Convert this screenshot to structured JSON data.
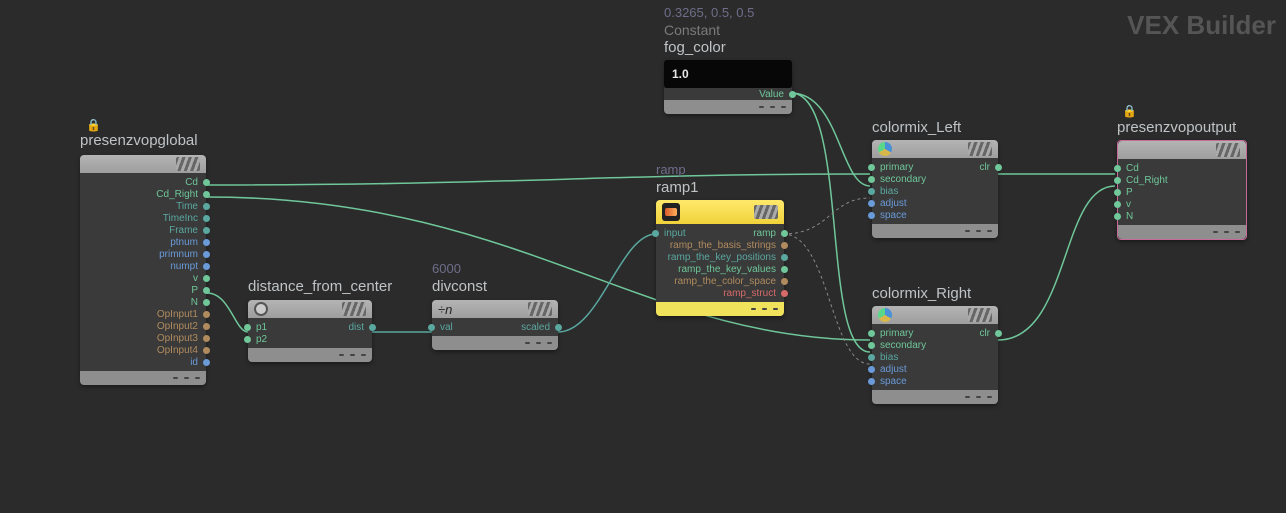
{
  "watermark": "VEX Builder",
  "constant": {
    "values_text": "0.3265, 0.5, 0.5",
    "type_text": "Constant",
    "name": "fog_color",
    "preview_value": "1.0",
    "out_label": "Value"
  },
  "global": {
    "name": "presenzvopglobal",
    "ports": [
      {
        "label": "Cd",
        "color": "green"
      },
      {
        "label": "Cd_Right",
        "color": "green"
      },
      {
        "label": "Time",
        "color": "teal"
      },
      {
        "label": "TimeInc",
        "color": "teal"
      },
      {
        "label": "Frame",
        "color": "teal"
      },
      {
        "label": "ptnum",
        "color": "blue"
      },
      {
        "label": "primnum",
        "color": "blue"
      },
      {
        "label": "numpt",
        "color": "blue"
      },
      {
        "label": "v",
        "color": "green"
      },
      {
        "label": "P",
        "color": "green"
      },
      {
        "label": "N",
        "color": "green"
      },
      {
        "label": "OpInput1",
        "color": "brown"
      },
      {
        "label": "OpInput2",
        "color": "brown"
      },
      {
        "label": "OpInput3",
        "color": "brown"
      },
      {
        "label": "OpInput4",
        "color": "brown"
      },
      {
        "label": "id",
        "color": "blue"
      }
    ]
  },
  "distance": {
    "name": "distance_from_center",
    "in": [
      {
        "label": "p1",
        "color": "green"
      },
      {
        "label": "p2",
        "color": "green"
      }
    ],
    "out": [
      {
        "label": "dist",
        "color": "teal"
      }
    ]
  },
  "divconst": {
    "value_text": "6000",
    "name": "divconst",
    "expr": "÷n",
    "in": [
      {
        "label": "val",
        "color": "teal"
      }
    ],
    "out": [
      {
        "label": "scaled",
        "color": "teal"
      }
    ]
  },
  "ramp": {
    "type_text": "ramp",
    "name": "ramp1",
    "in": [
      {
        "label": "input",
        "color": "teal"
      }
    ],
    "out": [
      {
        "label": "ramp",
        "color": "green"
      },
      {
        "label": "ramp_the_basis_strings",
        "color": "brown"
      },
      {
        "label": "ramp_the_key_positions",
        "color": "teal"
      },
      {
        "label": "ramp_the_key_values",
        "color": "green"
      },
      {
        "label": "ramp_the_color_space",
        "color": "brown"
      },
      {
        "label": "ramp_struct",
        "color": "red"
      }
    ]
  },
  "colormix_left": {
    "name": "colormix_Left",
    "in": [
      {
        "label": "primary",
        "color": "green"
      },
      {
        "label": "secondary",
        "color": "green"
      },
      {
        "label": "bias",
        "color": "teal"
      },
      {
        "label": "adjust",
        "color": "blue"
      },
      {
        "label": "space",
        "color": "blue"
      }
    ],
    "out": [
      {
        "label": "clr",
        "color": "green"
      }
    ]
  },
  "colormix_right": {
    "name": "colormix_Right",
    "in": [
      {
        "label": "primary",
        "color": "green"
      },
      {
        "label": "secondary",
        "color": "green"
      },
      {
        "label": "bias",
        "color": "teal"
      },
      {
        "label": "adjust",
        "color": "blue"
      },
      {
        "label": "space",
        "color": "blue"
      }
    ],
    "out": [
      {
        "label": "clr",
        "color": "green"
      }
    ]
  },
  "output": {
    "name": "presenzvopoutput",
    "in": [
      {
        "label": "Cd",
        "color": "green"
      },
      {
        "label": "Cd_Right",
        "color": "green"
      },
      {
        "label": "P",
        "color": "green"
      },
      {
        "label": "v",
        "color": "green"
      },
      {
        "label": "N",
        "color": "green"
      }
    ]
  }
}
